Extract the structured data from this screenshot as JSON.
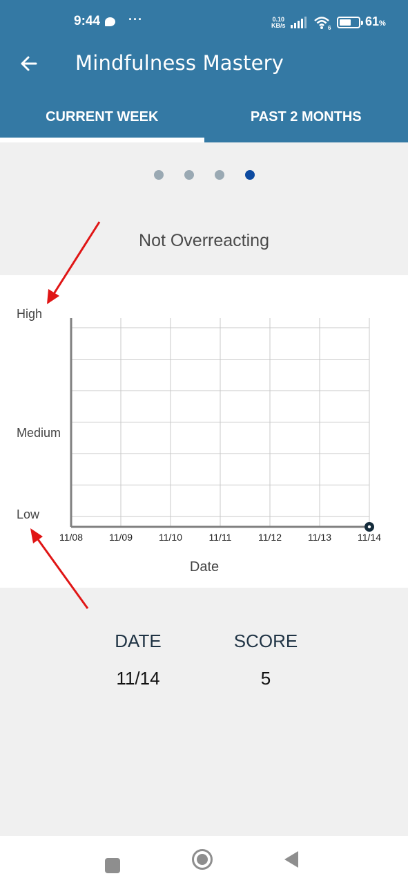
{
  "status_bar": {
    "time": "9:44",
    "more": "···",
    "net_speed_value": "0.10",
    "net_speed_unit": "KB/s",
    "wifi_badge": "6",
    "battery_percent": 61,
    "battery_label": "61",
    "battery_unit": "%"
  },
  "app_bar": {
    "title": "Mindfulness Mastery",
    "back_icon": "arrow-left-icon"
  },
  "tabs": [
    {
      "label": "CURRENT WEEK",
      "active": true
    },
    {
      "label": "PAST 2 MONTHS",
      "active": false
    }
  ],
  "pager": {
    "count": 4,
    "active_index": 3
  },
  "colors": {
    "header": "#3479a4",
    "pager_active": "#0d4aa0",
    "pager_inactive": "#9aa9b3",
    "data_point": "#142b3b",
    "annotation_arrow": "#e01515"
  },
  "chart_data": {
    "type": "scatter",
    "title": "Not Overreacting",
    "xlabel": "Date",
    "ylabel": "",
    "x_ticks": [
      "11/08",
      "11/09",
      "11/10",
      "11/11",
      "11/12",
      "11/13",
      "11/14"
    ],
    "y_tick_labels": [
      {
        "label": "High",
        "level": "high"
      },
      {
        "label": "Medium",
        "level": "medium"
      },
      {
        "label": "Low",
        "level": "low"
      }
    ],
    "y_grid_divisions": 6,
    "grid": true,
    "series": [
      {
        "name": "Not Overreacting",
        "points": [
          {
            "x": "11/14",
            "y": 5,
            "level": "low"
          }
        ]
      }
    ]
  },
  "table": {
    "headers": {
      "date": "DATE",
      "score": "SCORE"
    },
    "rows": [
      {
        "date": "11/14",
        "score": "5"
      }
    ]
  },
  "nav_bar": {
    "recent": "recent-apps-icon",
    "home": "home-icon",
    "back": "back-triangle-icon"
  }
}
